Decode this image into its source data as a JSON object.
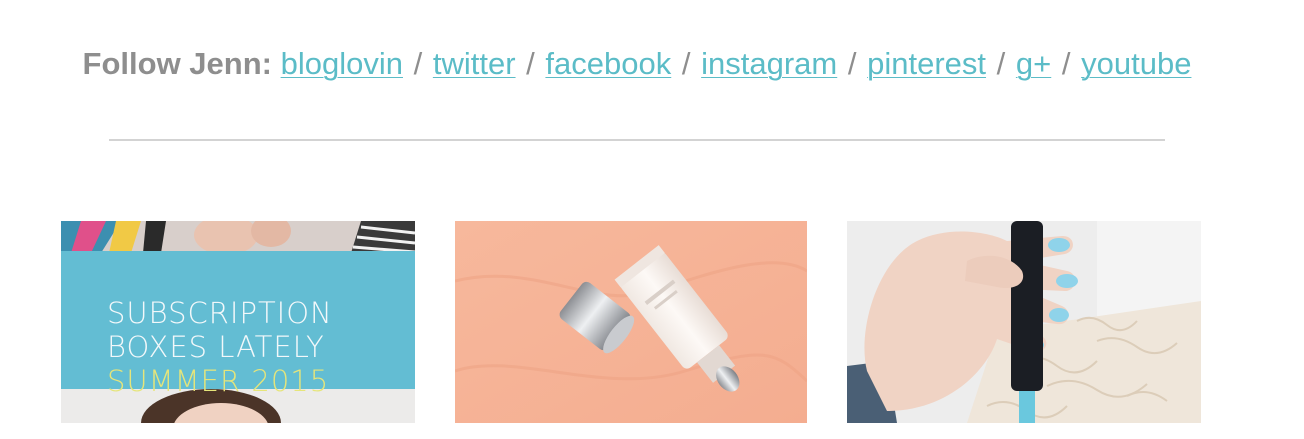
{
  "follow": {
    "label": "Follow Jenn:",
    "separator": "/",
    "links": [
      {
        "label": "bloglovin"
      },
      {
        "label": "twitter"
      },
      {
        "label": "facebook"
      },
      {
        "label": "instagram"
      },
      {
        "label": "pinterest"
      },
      {
        "label": "g+"
      },
      {
        "label": "youtube"
      }
    ]
  },
  "thumbnails": {
    "first": {
      "banner_lines": [
        "SUBSCRIPTION",
        "BOXES LATELY",
        "SUMMER 2015"
      ]
    }
  },
  "colors": {
    "link": "#5bbcc7",
    "label": "#8e8e8e",
    "divider": "#d3d3d3",
    "banner_bg": "#63bdd3",
    "banner_text": "#f2f8fa",
    "banner_highlight": "#e6e57a"
  }
}
